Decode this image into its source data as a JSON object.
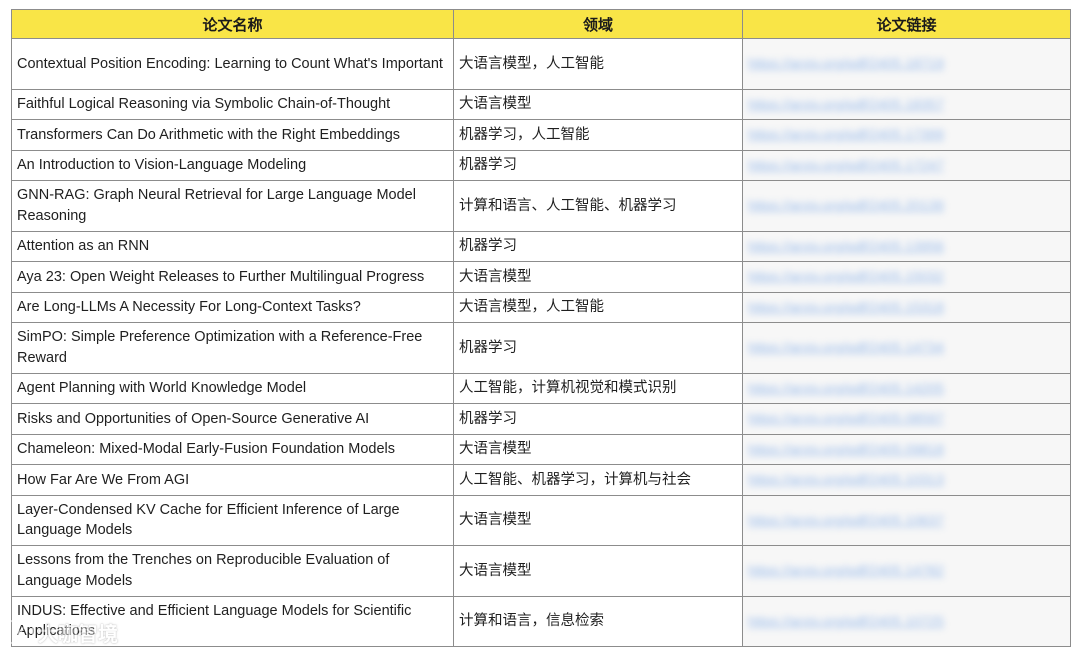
{
  "table": {
    "headers": [
      "论文名称",
      "领域",
      "论文链接"
    ],
    "rows": [
      {
        "title": "Contextual Position Encoding: Learning to Count What's Important",
        "field": "大语言模型，人工智能",
        "link": "https://arxiv.org/pdf/2405.18719"
      },
      {
        "title": "Faithful Logical Reasoning via Symbolic Chain-of-Thought",
        "field": "大语言模型",
        "link": "https://arxiv.org/pdf/2405.18357"
      },
      {
        "title": "Transformers Can Do Arithmetic with the Right Embeddings",
        "field": "机器学习，人工智能",
        "link": "https://arxiv.org/pdf/2405.17399"
      },
      {
        "title": "An Introduction to Vision-Language Modeling",
        "field": "机器学习",
        "link": "https://arxiv.org/pdf/2405.17247"
      },
      {
        "title": "GNN-RAG: Graph Neural Retrieval for Large Language Model Reasoning",
        "field": "计算和语言、人工智能、机器学习",
        "link": "https://arxiv.org/pdf/2405.20139"
      },
      {
        "title": "Attention as an RNN",
        "field": "机器学习",
        "link": "https://arxiv.org/pdf/2405.13956"
      },
      {
        "title": "Aya 23: Open Weight Releases to Further Multilingual Progress",
        "field": "大语言模型",
        "link": "https://arxiv.org/pdf/2405.15032"
      },
      {
        "title": "Are Long-LLMs A Necessity For Long-Context Tasks?",
        "field": "大语言模型，人工智能",
        "link": "https://arxiv.org/pdf/2405.15318"
      },
      {
        "title": "SimPO: Simple Preference Optimization with a Reference-Free Reward",
        "field": "机器学习",
        "link": "https://arxiv.org/pdf/2405.14734"
      },
      {
        "title": "Agent Planning with World Knowledge Model",
        "field": "人工智能，计算机视觉和模式识别",
        "link": "https://arxiv.org/pdf/2405.14205"
      },
      {
        "title": "Risks and Opportunities of Open-Source Generative AI",
        "field": "机器学习",
        "link": "https://arxiv.org/pdf/2405.08597"
      },
      {
        "title": "Chameleon: Mixed-Modal Early-Fusion Foundation Models",
        "field": "大语言模型",
        "link": "https://arxiv.org/pdf/2405.09818"
      },
      {
        "title": "How Far Are We From AGI",
        "field": "人工智能、机器学习，计算机与社会",
        "link": "https://arxiv.org/pdf/2405.10313"
      },
      {
        "title": "Layer-Condensed KV Cache for Efficient Inference of Large Language Models",
        "field": "大语言模型",
        "link": "https://arxiv.org/pdf/2405.10637"
      },
      {
        "title": "Lessons from the Trenches on Reproducible Evaluation of Language Models",
        "field": "大语言模型",
        "link": "https://arxiv.org/pdf/2405.14782"
      },
      {
        "title": "INDUS: Effective and Efficient Language Models for Scientific Applications",
        "field": "计算和语言，信息检索",
        "link": "https://arxiv.org/pdf/2405.10725"
      }
    ]
  },
  "watermark": {
    "text": "大咖智境"
  }
}
